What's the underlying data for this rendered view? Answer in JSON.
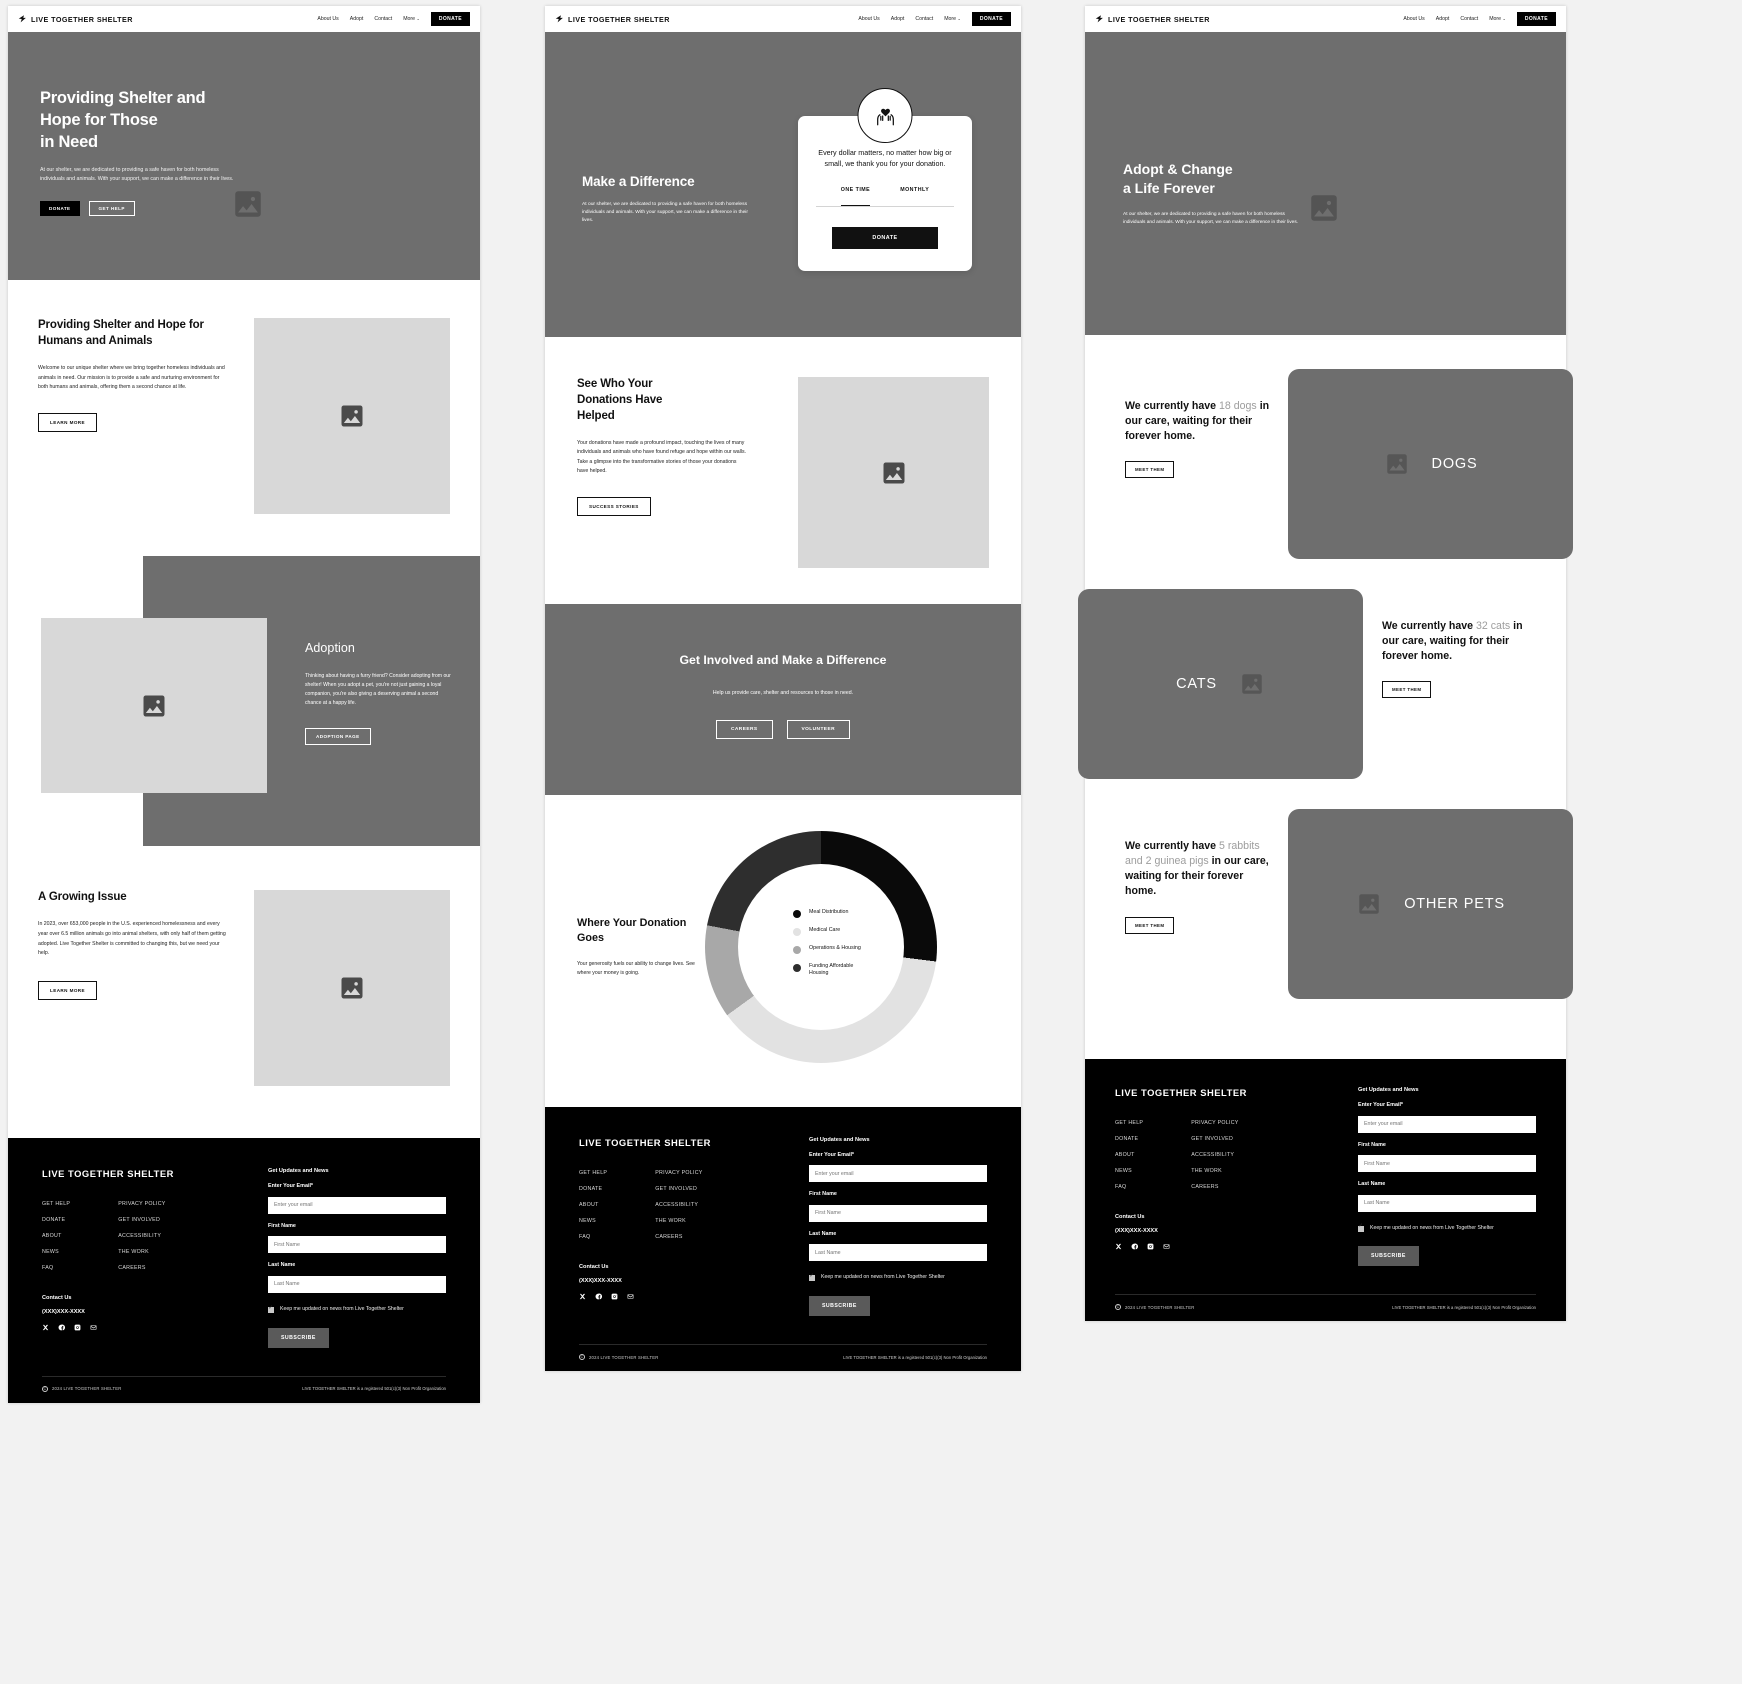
{
  "brand": {
    "name": "LIVE TOGETHER SHELTER",
    "logo_icon": "shelter-roof-icon"
  },
  "nav": {
    "links": [
      "About Us",
      "Adopt",
      "Contact",
      "More"
    ],
    "more_caret": "⌄",
    "donate": "DONATE"
  },
  "page1": {
    "hero": {
      "title": "Providing Shelter and\nHope for Those\nin Need",
      "body": "At our shelter, we are dedicated to providing a safe haven for both homeless individuals and animals. With your support, we can make a difference in their lives.",
      "btn_primary": "DONATE",
      "btn_secondary": "GET HELP",
      "image_icon": "image-placeholder-icon"
    },
    "intro": {
      "title": "Providing Shelter and Hope for Humans and Animals",
      "body": "Welcome to our unique shelter where we bring together homeless individuals and animals in need. Our mission is to provide a safe and nurturing environment for both humans and animals, offering them a second chance at life.",
      "button": "LEARN MORE",
      "image_icon": "image-placeholder-icon"
    },
    "adoption": {
      "title": "Adoption",
      "body": "Thinking about having a furry friend? Consider adopting from our shelter! When you adopt a pet, you're not just gaining a loyal companion, you're also giving a deserving animal a second chance at a happy life.",
      "button": "ADOPTION PAGE",
      "image_icon": "image-placeholder-icon"
    },
    "growing": {
      "title": "A Growing Issue",
      "body": "In 2023, over 653,000 people in the U.S. experienced homelessness and every year over 6.5 million animals go into animal shelters, with only half of them getting adopted. Live Together Shelter is committed to changing this, but we need your help.",
      "button": "LEARN MORE",
      "image_icon": "image-placeholder-icon"
    }
  },
  "page2": {
    "hero": {
      "title": "Make a Difference",
      "body": "At our shelter, we are dedicated to providing a safe haven for both homeless individuals and animals. With your support, we can make a difference in their lives."
    },
    "donate_card": {
      "icon": "heart-in-hands-icon",
      "message": "Every dollar matters, no matter how big or small, we thank you for your donation.",
      "tabs": [
        "ONE TIME",
        "MONTHLY"
      ],
      "active_tab": "ONE TIME",
      "button": "DONATE"
    },
    "impact": {
      "title": "See Who Your Donations Have Helped",
      "body": "Your donations have made a profound impact, touching the lives of many individuals and animals who have found refuge and hope within our walls. Take a glimpse into the transformative stories of those your donations have helped.",
      "button": "SUCCESS STORIES",
      "image_icon": "image-placeholder-icon"
    },
    "involve": {
      "title": "Get Involved and Make a Difference",
      "body": "Help us provide care, shelter and resources to those in need.",
      "btn_careers": "CAREERS",
      "btn_volunteer": "VOLUNTEER"
    },
    "donation_chart": {
      "title": "Where Your Donation Goes",
      "body": "Your generosity fuels our ability to change lives. See where your money is going."
    }
  },
  "page3": {
    "hero": {
      "title": "Adopt & Change\na Life Forever",
      "body": "At our shelter, we are dedicated to providing a safe haven for both homeless individuals and animals. With your support, we can make a difference in their lives.",
      "image_icon": "image-placeholder-icon"
    },
    "pets": [
      {
        "prefix": "We currently have",
        "count": "18 dogs",
        "suffix": "in our care, waiting for their forever home.",
        "button": "MEET THEM",
        "card_label": "DOGS",
        "image_icon": "image-placeholder-icon"
      },
      {
        "prefix": "We currently have",
        "count": "32 cats",
        "suffix": "in our care, waiting for their forever home.",
        "button": "MEET THEM",
        "card_label": "CATS",
        "image_icon": "image-placeholder-icon"
      },
      {
        "prefix": "We currently have",
        "count": "5 rabbits and 2 guinea pigs",
        "suffix": "in our care, waiting for their forever home.",
        "button": "MEET THEM",
        "card_label": "OTHER PETS",
        "image_icon": "image-placeholder-icon"
      }
    ]
  },
  "footer": {
    "brand": "LIVE TOGETHER SHELTER",
    "col1": [
      "GET HELP",
      "DONATE",
      "ABOUT",
      "NEWS",
      "FAQ"
    ],
    "col2": [
      "PRIVACY POLICY",
      "GET INVOLVED",
      "ACCESSIBILITY",
      "THE WORK",
      "CAREERS"
    ],
    "contact_title": "Contact Us",
    "phone": "(XXX)XXX-XXXX",
    "socials": [
      "x-icon",
      "facebook-icon",
      "instagram-icon",
      "email-icon"
    ],
    "news_title": "Get Updates and News",
    "email_label": "Enter Your Email*",
    "email_placeholder": "Enter your email",
    "first_label": "First Name",
    "first_placeholder": "First Name",
    "last_label": "Last Name",
    "last_placeholder": "Last Name",
    "checkbox_label": "Keep me updated on news from Live Together Shelter",
    "checkbox_checked": true,
    "subscribe": "SUBSCRIBE",
    "copyright": "2024 LIVE TOGETHER SHELTER",
    "legal": "LIVE TOGETHER SHELTER is a registered 501(c)(3) Non Profit Organization"
  },
  "chart_data": {
    "type": "pie",
    "title": "Where Your Donation Goes",
    "categories": [
      "Meal Distribution",
      "Medical Care",
      "Operations & Housing",
      "Funding Affordable Housing"
    ],
    "values": [
      27,
      38,
      13,
      22
    ],
    "colors": [
      "#0a0a0a",
      "#e2e2e2",
      "#a8a8a8",
      "#2e2e2e"
    ],
    "legend_position": "center-right",
    "grid": false,
    "xlabel": "",
    "ylabel": ""
  }
}
